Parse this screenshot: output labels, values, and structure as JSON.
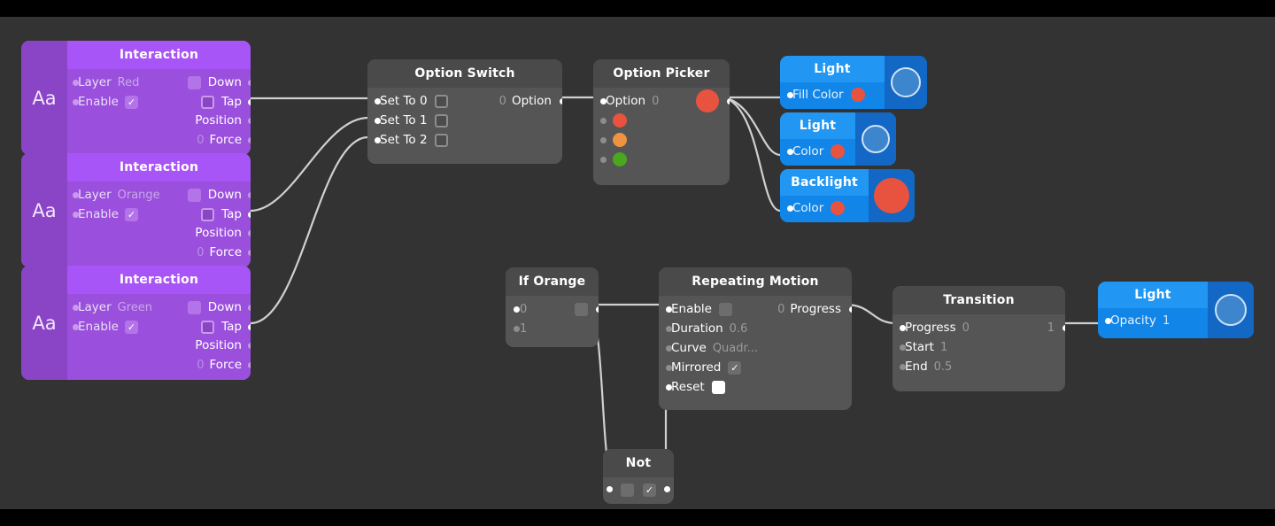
{
  "app": {
    "title": "Node Graph Canvas",
    "background_color": "#333333",
    "letterbox_color": "#000000"
  },
  "colors": {
    "purple_node": "#9b4fdd",
    "purple_header": "#a855f7",
    "purple_side": "#8a45c6",
    "gray_node": "#555555",
    "gray_header": "#4a4a4a",
    "blue_node": "#1186e8",
    "blue_header": "#2196f3",
    "blue_side": "#1268c4",
    "wire": "#d0d0d0",
    "port": "#ffffff",
    "port_muted": "#8d8d8d",
    "swatch_red": "#e8533f",
    "swatch_orange": "#ef9340",
    "swatch_green": "#49a81e"
  },
  "nodes": {
    "interaction_red": {
      "title": "Interaction",
      "icon_label": "Aa",
      "rows": [
        {
          "label": "Layer",
          "value": "Red"
        },
        {
          "label": "Enable",
          "value": "checked"
        }
      ],
      "outputs": [
        {
          "label": "Down",
          "control": "checkbox"
        },
        {
          "label": "Tap",
          "control": "radio"
        },
        {
          "label": "Position",
          "control": "none"
        },
        {
          "label": "Force",
          "control": "none",
          "prefix": "0"
        }
      ]
    },
    "interaction_orange": {
      "title": "Interaction",
      "icon_label": "Aa",
      "rows": [
        {
          "label": "Layer",
          "value": "Orange"
        },
        {
          "label": "Enable",
          "value": "checked"
        }
      ],
      "outputs": [
        {
          "label": "Down",
          "control": "checkbox"
        },
        {
          "label": "Tap",
          "control": "radio"
        },
        {
          "label": "Position",
          "control": "none"
        },
        {
          "label": "Force",
          "control": "none",
          "prefix": "0"
        }
      ]
    },
    "interaction_green": {
      "title": "Interaction",
      "icon_label": "Aa",
      "rows": [
        {
          "label": "Layer",
          "value": "Green"
        },
        {
          "label": "Enable",
          "value": "checked"
        }
      ],
      "outputs": [
        {
          "label": "Down",
          "control": "checkbox"
        },
        {
          "label": "Tap",
          "control": "radio"
        },
        {
          "label": "Position",
          "control": "none"
        },
        {
          "label": "Force",
          "control": "none",
          "prefix": "0"
        }
      ]
    },
    "option_switch": {
      "title": "Option Switch",
      "inputs": [
        {
          "label": "Set To 0"
        },
        {
          "label": "Set To 1"
        },
        {
          "label": "Set To 2"
        }
      ],
      "output": {
        "label": "Option",
        "value": "0"
      }
    },
    "option_picker": {
      "title": "Option Picker",
      "input": {
        "label": "Option",
        "value": "0"
      },
      "options": [
        "#e8533f",
        "#ef9340",
        "#49a81e"
      ],
      "selected_color": "#e8533f"
    },
    "light_fill": {
      "title": "Light",
      "rows": [
        {
          "label": "Fill Color",
          "swatch": "#e8533f"
        }
      ],
      "preview": "ring"
    },
    "light_color": {
      "title": "Light",
      "rows": [
        {
          "label": "Color",
          "swatch": "#e8533f"
        }
      ],
      "preview": "ring"
    },
    "backlight": {
      "title": "Backlight",
      "rows": [
        {
          "label": "Color",
          "swatch": "#e8533f"
        }
      ],
      "preview": "solid-red"
    },
    "if_orange": {
      "title": "If Orange",
      "inputs": [
        {
          "label": "0"
        },
        {
          "label": "1"
        }
      ],
      "output": {
        "control": "checkbox"
      }
    },
    "repeating_motion": {
      "title": "Repeating Motion",
      "rows": [
        {
          "label": "Enable",
          "control": "checkbox-gray"
        },
        {
          "label": "Duration",
          "value": "0.6"
        },
        {
          "label": "Curve",
          "value": "Quadr..."
        },
        {
          "label": "Mirrored",
          "control": "checkbox-checked"
        },
        {
          "label": "Reset",
          "control": "checkbox-white"
        }
      ],
      "output": {
        "label": "Progress",
        "prefix": "0"
      }
    },
    "transition": {
      "title": "Transition",
      "rows": [
        {
          "label": "Progress",
          "value": "0"
        },
        {
          "label": "Start",
          "value": "1"
        },
        {
          "label": "End",
          "value": "0.5"
        }
      ],
      "output_value": "1"
    },
    "light_opacity": {
      "title": "Light",
      "rows": [
        {
          "label": "Opacity",
          "value": "1"
        }
      ],
      "preview": "ring"
    }
  }
}
